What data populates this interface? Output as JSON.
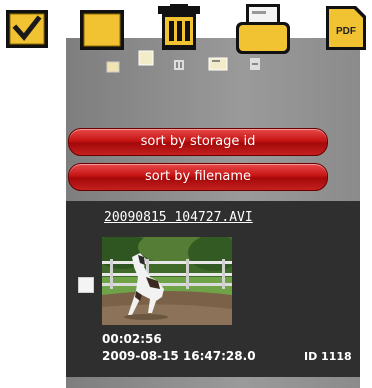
{
  "toolbar": {
    "icons": [
      "checkbox-icon",
      "blank-document-icon",
      "trash-icon",
      "folder-icon",
      "pdf-icon"
    ],
    "pdf_label": "PDF"
  },
  "sort_buttons": {
    "storage_label": "sort by storage id",
    "filename_label": "sort by filename"
  },
  "media_item": {
    "filename": "20090815 104727.AVI",
    "duration": "00:02:56",
    "datetime": "2009-08-15 16:47:28.0",
    "storage_id": "ID 1118"
  },
  "colors": {
    "icon_yellow": "#f1c232",
    "button_red": "#c51414",
    "card_bg": "#2f2f2f",
    "panel_gray": "#8b8b8b"
  }
}
